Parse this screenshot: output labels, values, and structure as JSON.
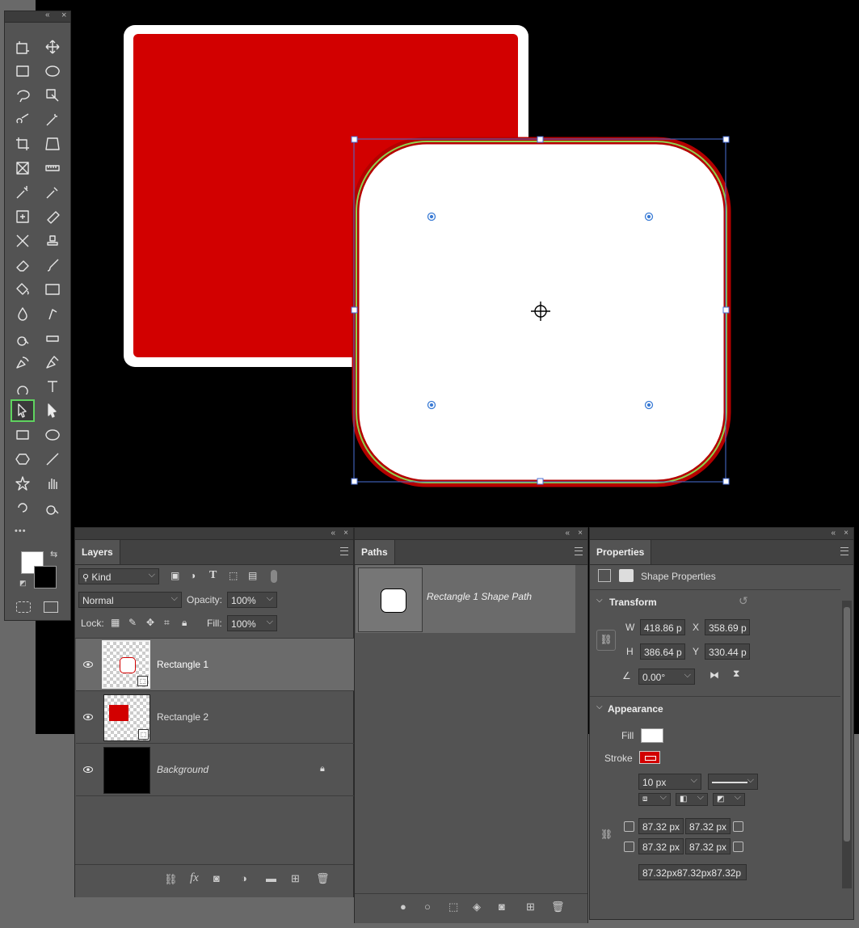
{
  "colors": {
    "red": "#d20000",
    "selection": "#3a6ed8",
    "active_outline": "#5fd35f"
  },
  "toolbar": {
    "collapse": "«",
    "close": "×",
    "tools": [
      [
        "artboard-icon",
        "move-icon"
      ],
      [
        "rect-marquee-icon",
        "ellipse-marquee-icon"
      ],
      [
        "lasso-icon",
        "object-select-icon"
      ],
      [
        "quick-select-icon",
        "magic-wand-icon"
      ],
      [
        "crop-icon",
        "perspective-crop-icon"
      ],
      [
        "frame-icon",
        "ruler-icon"
      ],
      [
        "color-sampler-icon",
        "eyedropper-icon"
      ],
      [
        "spot-heal-icon",
        "bandaid-icon"
      ],
      [
        "content-aware-move-icon",
        "stamp-icon"
      ],
      [
        "eraser-icon",
        "brush-icon"
      ],
      [
        "paint-bucket-icon",
        "gradient-icon"
      ],
      [
        "blur-icon",
        "smudge-icon"
      ],
      [
        "dodge-icon",
        "sponge-icon"
      ],
      [
        "freeform-pen-icon",
        "pen-icon"
      ],
      [
        "pattern-stamp-icon",
        "type-icon"
      ],
      [
        "path-select-icon",
        "direct-select-icon"
      ],
      [
        "rectangle-tool-icon",
        "ellipse-tool-icon"
      ],
      [
        "polygon-tool-icon",
        "line-tool-icon"
      ],
      [
        "custom-shape-icon",
        "hand-icon"
      ],
      [
        "rotate-view-icon",
        "zoom-icon"
      ]
    ],
    "more": "•••"
  },
  "layers_panel": {
    "tab": "Layers",
    "filter_kind": "Kind",
    "blend_mode": "Normal",
    "opacity_label": "Opacity:",
    "opacity": "100%",
    "lock_label": "Lock:",
    "fill_label": "Fill:",
    "fill": "100%",
    "layers": [
      {
        "name": "Rectangle 1",
        "selected": true
      },
      {
        "name": "Rectangle 2",
        "selected": false
      },
      {
        "name": "Background",
        "selected": false
      }
    ],
    "fx": "fx"
  },
  "paths_panel": {
    "tab": "Paths",
    "paths": [
      {
        "name": "Rectangle 1 Shape Path"
      }
    ]
  },
  "properties_panel": {
    "tab": "Properties",
    "header": "Shape Properties",
    "transform": {
      "title": "Transform",
      "w_label": "W",
      "w": "418.86 p",
      "x_label": "X",
      "x": "358.69 p",
      "h_label": "H",
      "h": "386.64 p",
      "y_label": "Y",
      "y": "330.44 p",
      "angle": "0.00°"
    },
    "appearance": {
      "title": "Appearance",
      "fill_label": "Fill",
      "stroke_label": "Stroke",
      "stroke_width": "10 px",
      "radius_tl": "87.32 px",
      "radius_tr": "87.32 px",
      "radius_bl": "87.32 px",
      "radius_br": "87.32 px",
      "radius_all": "87.32px87.32px87.32p"
    }
  }
}
